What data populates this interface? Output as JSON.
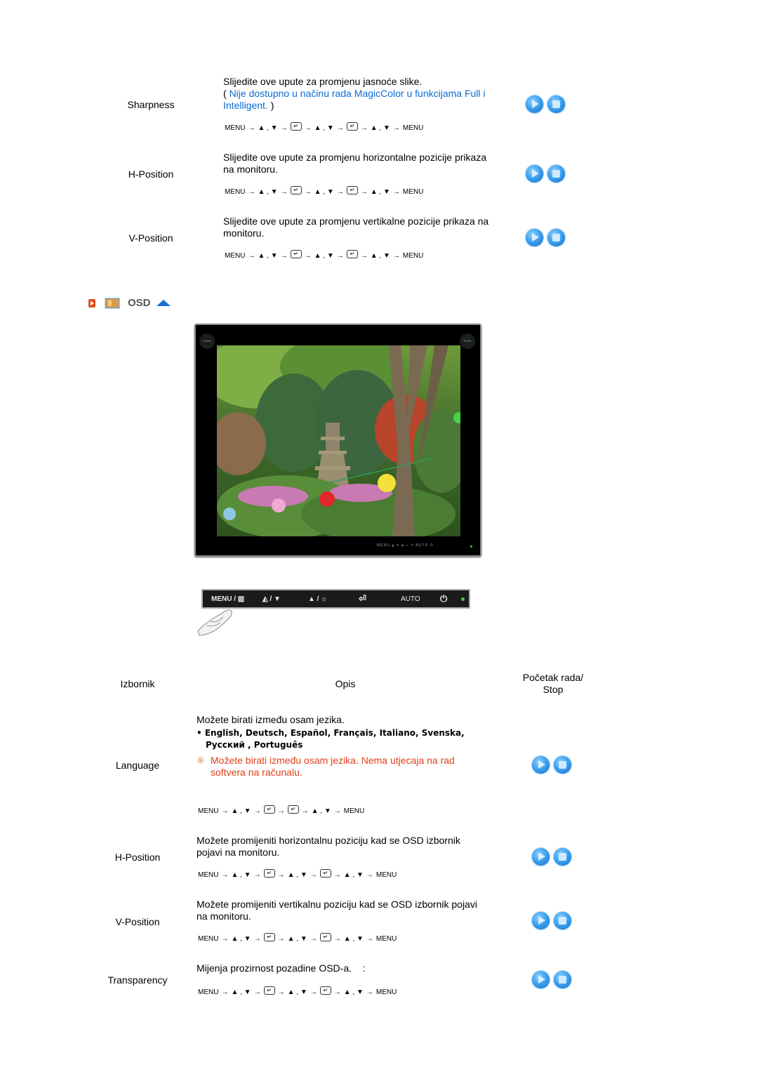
{
  "picture_section": {
    "rows": [
      {
        "label": "Sharpness",
        "description": "Slijedite ove upute za promjenu jasnoće slike.",
        "note_open": "( ",
        "note_link": "Nije dostupno u načinu rada MagicColor u funkcijama Full i Intelligent.",
        "note_close": " )",
        "sequence": [
          "MENU",
          "→",
          "▲ , ▼",
          "→",
          "enter",
          "→",
          "▲ , ▼",
          "→",
          "enter",
          "→",
          "▲ , ▼",
          "→",
          "MENU"
        ]
      },
      {
        "label": "H-Position",
        "description": "Slijedite ove upute za promjenu horizontalne pozicije prikaza na monitoru.",
        "sequence": [
          "MENU",
          "→",
          "▲ , ▼",
          "→",
          "enter",
          "→",
          "▲ , ▼",
          "→",
          "enter",
          "→",
          "▲ , ▼",
          "→",
          "MENU"
        ]
      },
      {
        "label": "V-Position",
        "description": "Slijedite ove upute za promjenu vertikalne pozicije prikaza na monitoru.",
        "sequence": [
          "MENU",
          "→",
          "▲ , ▼",
          "→",
          "enter",
          "→",
          "▲ , ▼",
          "→",
          "enter",
          "→",
          "▲ , ▼",
          "→",
          "MENU"
        ]
      }
    ]
  },
  "osd_section": {
    "title": "OSD",
    "icons": [
      "play-square-icon",
      "monitor-icon",
      "up-arrow-icon"
    ],
    "monitor": {
      "push_left": "PUSH",
      "push_right": "PUSH",
      "bezel_buttons": "MENU  ◭ ▾  ▲☼  ⏎  AUTO  ⏻"
    },
    "control_panel": {
      "buttons": [
        "MENU / ▥",
        "◭ / ▼",
        "▲ / ☼",
        "⏎",
        "AUTO",
        "⏻"
      ],
      "power_led_color": "#3cd23c"
    },
    "table_headers": {
      "menu": "Izbornik",
      "description": "Opis",
      "play_stop": "Početak rada/  Stop"
    },
    "rows": [
      {
        "label": "Language",
        "description": "Možete birati između osam jezika.",
        "languages_line1": "• English, Deutsch, Español, Français,  Italiano, Svenska,",
        "languages_line2": "Русский , Português",
        "note_mark": "※",
        "note": "Možete birati između osam jezika. Nema utjecaja na rad softvera na računalu.",
        "sequence": [
          "MENU",
          "→",
          "▲ , ▼",
          "→",
          "enter",
          "→",
          "enter",
          "→",
          "▲ , ▼",
          "→",
          "MENU"
        ]
      },
      {
        "label": "H-Position",
        "description": "Možete promijeniti horizontalnu poziciju kad se OSD izbornik pojavi na monitoru.",
        "sequence": [
          "MENU",
          "→",
          "▲ , ▼",
          "→",
          "enter",
          "→",
          "▲ , ▼",
          "→",
          "enter",
          "→",
          "▲ , ▼",
          "→",
          "MENU"
        ]
      },
      {
        "label": "V-Position",
        "description": "Možete promijeniti vertikalnu poziciju kad se OSD izbornik pojavi na monitoru.",
        "sequence": [
          "MENU",
          "→",
          "▲ , ▼",
          "→",
          "enter",
          "→",
          "▲ , ▼",
          "→",
          "enter",
          "→",
          "▲ , ▼",
          "→",
          "MENU"
        ]
      },
      {
        "label": "Transparency",
        "description": "Mijenja prozirnost pozadine OSD-a.    :",
        "sequence": [
          "MENU",
          "→",
          "▲ , ▼",
          "→",
          "enter",
          "→",
          "▲ , ▼",
          "→",
          "enter",
          "→",
          "▲ , ▼",
          "→",
          "MENU"
        ]
      }
    ]
  },
  "buttons": {
    "play_label": "Play",
    "stop_label": "Stop"
  },
  "colors": {
    "link": "#0a6bd6",
    "warning": "#e0401a",
    "accent": "#1573d4"
  }
}
